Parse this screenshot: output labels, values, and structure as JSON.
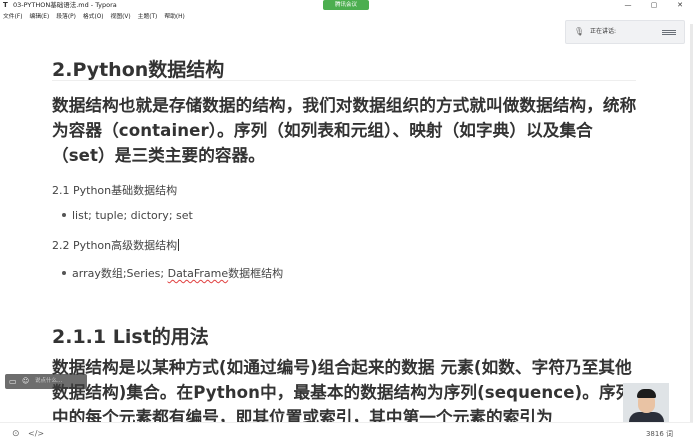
{
  "window": {
    "app_icon": "T",
    "title": "03-PYTHON基础语法.md - Typora",
    "controls": [
      "—",
      "▢",
      "✕"
    ]
  },
  "menu": [
    "文件(F)",
    "编辑(E)",
    "段落(P)",
    "格式(O)",
    "视图(V)",
    "主题(T)",
    "帮助(H)"
  ],
  "meeting": {
    "pill_label": "腾讯会议",
    "speaking_label": "正在讲话:"
  },
  "document": {
    "h2": "2.Python数据结构",
    "intro": "数据结构也就是存储数据的结构，我们对数据组织的方式就叫做数据结构，统称为容器（container）。序列（如列表和元组）、映射（如字典）以及集合（set）是三类主要的容器。",
    "sub1": "2.1 Python基础数据结构",
    "bullet1": "list; tuple; dictory; set",
    "sub2": "2.2 Python高级数据结构",
    "bullet2_pre": "array数组;Series; ",
    "bullet2_flag": "DataFrame",
    "bullet2_post": "数据框结构",
    "h3": "2.1.1 List的用法",
    "para2": "数据结构是以某种方式(如通过编号)组合起来的数据 元素(如数、字符乃至其他数据结构)集合。在Python中，最基本的数据结构为序列(sequence)。序列中的每个元素都有编号，即其位置或索引，其中第一个元素的索引为"
  },
  "danmaku": {
    "placeholder": "说点什么..."
  },
  "status": {
    "word_count": "3816 词"
  },
  "icons": {
    "mic": "microphone-icon",
    "source_toggle": "code-icon",
    "outline_toggle": "circle-icon"
  },
  "colors": {
    "accent_green": "#4cae4f",
    "spell_error": "#e04040"
  }
}
